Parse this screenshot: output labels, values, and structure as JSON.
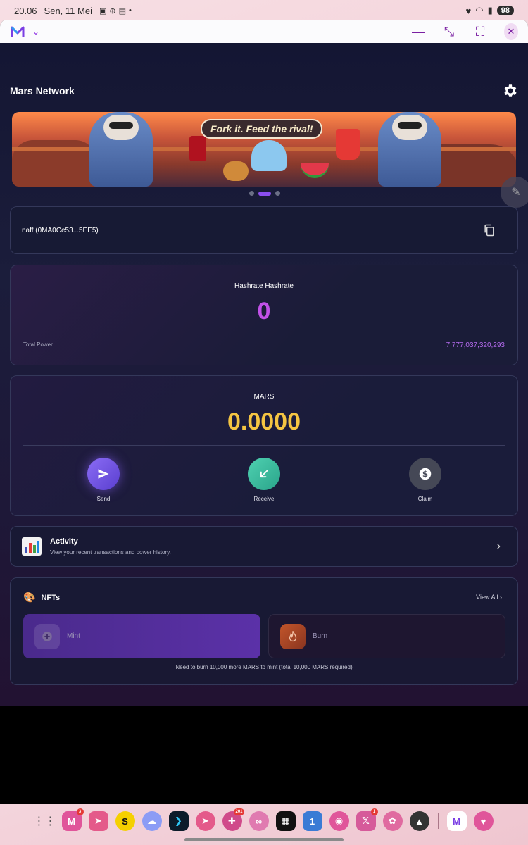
{
  "status_bar": {
    "time": "20.06",
    "date": "Sen, 11 Mei",
    "battery": "98"
  },
  "app": {
    "title": "Mars Network"
  },
  "banner": {
    "caption": "Fork it. Feed the rival!",
    "slides": 3,
    "active_slide": 1
  },
  "wallet": {
    "label": "naff (0MA0Ce53...5EE5)"
  },
  "hashrate": {
    "label": "Hashrate Hashrate",
    "value": "0",
    "total_power_label": "Total Power",
    "total_power_value": "7,777,037,320,293"
  },
  "mars": {
    "label": "MARS",
    "balance": "0.0000",
    "actions": {
      "send": "Send",
      "receive": "Receive",
      "claim": "Claim"
    }
  },
  "activity": {
    "title": "Activity",
    "subtitle": "View your recent transactions and power history."
  },
  "nfts": {
    "title": "NFTs",
    "view_all": "View All",
    "mint": "Mint",
    "burn": "Burn",
    "note": "Need to burn 10,000 more MARS to mint (total 10,000 MARS required)"
  },
  "dock": {
    "badges": {
      "mars": "3",
      "chat": "201",
      "x": "1"
    }
  },
  "colors": {
    "accent_purple": "#8a4ef0",
    "hashrate": "#c251e8",
    "mars_gold": "#f5c542",
    "receive_green": "#2aa48a"
  }
}
